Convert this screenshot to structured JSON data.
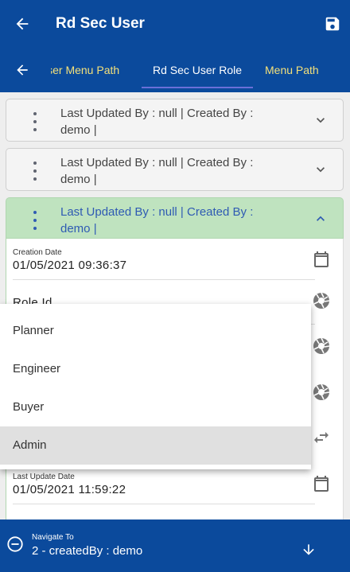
{
  "app": {
    "title": "Rd Sec User"
  },
  "tabs": [
    {
      "label": "User Menu Path"
    },
    {
      "label": "Rd Sec User Role"
    },
    {
      "label": "Menu Path"
    }
  ],
  "cards": [
    {
      "text_line1": "Last Updated By  : null | Created By  :",
      "text_line2": "demo |"
    },
    {
      "text_line1": "Last Updated By  : null | Created By  :",
      "text_line2": "demo |"
    },
    {
      "text_line1": "Last Updated By  : null | Created By  :",
      "text_line2": "demo |"
    }
  ],
  "detail": {
    "creation_date": {
      "label": "Creation Date",
      "value": "01/05/2021 09:36:37"
    },
    "role_id": {
      "label": "Role Id"
    },
    "last_update_date": {
      "label": "Last Update Date",
      "value": "01/05/2021 11:59:22"
    }
  },
  "dropdown": {
    "options": [
      "Planner",
      "Engineer",
      "Buyer",
      "Admin"
    ],
    "selected": "Admin"
  },
  "navigate": {
    "label": "Navigate To",
    "value": "2 - createdBy : demo"
  },
  "colors": {
    "primary": "#0b4a9c",
    "tab_inactive": "#f3e07a",
    "expanded_card": "#bfe3bf",
    "indicator": "#6a6fd8"
  }
}
